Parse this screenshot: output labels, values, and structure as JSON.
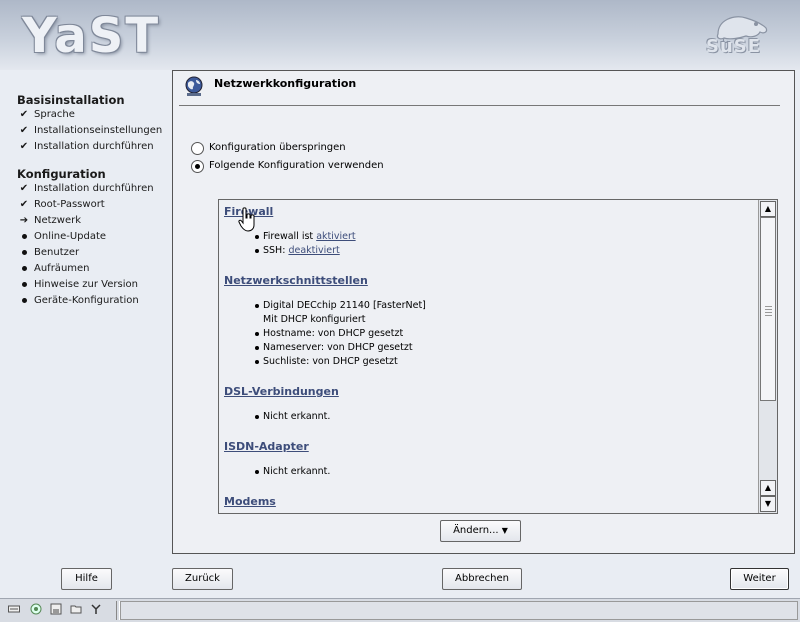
{
  "header": {
    "logo_text": "YaST",
    "vendor_text": "SuSE"
  },
  "sidebar": {
    "sections": [
      {
        "title": "Basisinstallation",
        "items": [
          {
            "label": "Sprache",
            "state": "done"
          },
          {
            "label": "Installationseinstellungen",
            "state": "done"
          },
          {
            "label": "Installation durchführen",
            "state": "done"
          }
        ]
      },
      {
        "title": "Konfiguration",
        "items": [
          {
            "label": "Installation durchführen",
            "state": "done"
          },
          {
            "label": "Root-Passwort",
            "state": "done"
          },
          {
            "label": "Netzwerk",
            "state": "current"
          },
          {
            "label": "Online-Update",
            "state": "todo"
          },
          {
            "label": "Benutzer",
            "state": "todo"
          },
          {
            "label": "Aufräumen",
            "state": "todo"
          },
          {
            "label": "Hinweise zur Version",
            "state": "todo"
          },
          {
            "label": "Geräte-Konfiguration",
            "state": "todo"
          }
        ]
      }
    ]
  },
  "main": {
    "title": "Netzwerkkonfiguration",
    "title_icon": "network-globe-icon",
    "options": [
      {
        "label": "Konfiguration überspringen",
        "selected": false
      },
      {
        "label": "Folgende Konfiguration verwenden",
        "selected": true
      }
    ],
    "summary": {
      "firewall": {
        "heading": "Firewall",
        "line1_prefix": "Firewall ist ",
        "line1_link": "aktiviert",
        "line2_prefix": "SSH: ",
        "line2_link": "deaktiviert"
      },
      "interfaces": {
        "heading": "Netzwerkschnittstellen",
        "items": [
          "Digital DECchip 21140 [FasterNet]",
          "Mit DHCP konfiguriert",
          "Hostname: von DHCP gesetzt",
          "Nameserver: von DHCP gesetzt",
          "Suchliste: von DHCP gesetzt"
        ]
      },
      "dsl": {
        "heading": "DSL-Verbindungen",
        "item": "Nicht erkannt."
      },
      "isdn": {
        "heading": "ISDN-Adapter",
        "item": "Nicht erkannt."
      },
      "modems": {
        "heading": "Modems"
      }
    },
    "change_button": "Ändern...",
    "change_arrow": "▼"
  },
  "buttons": {
    "help": "Hilfe",
    "back": "Zurück",
    "abort": "Abbrechen",
    "next": "Weiter"
  },
  "scroll": {
    "up": "▲",
    "down": "▼"
  },
  "sidebar_marks": {
    "done": "✔",
    "current": "➔"
  },
  "colors": {
    "link": "#3d4d7a",
    "background": "#e9edf3"
  }
}
